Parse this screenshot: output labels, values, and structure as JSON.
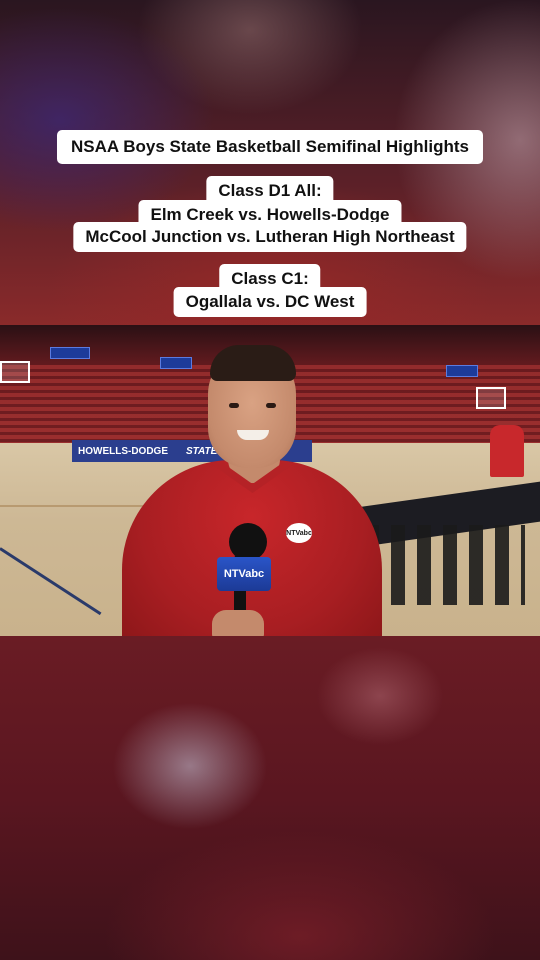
{
  "caption": {
    "title": "NSAA Boys State Basketball Semifinal Highlights",
    "d1_header": "Class D1 All:",
    "d1_game1": "Elm Creek vs. Howells-Dodge",
    "d1_game2": "McCool Junction vs. Lutheran High Northeast",
    "c1_header": "Class C1:",
    "c1_game1": "Ogallala vs. DC West"
  },
  "video": {
    "banner_left": "HOWELLS-DODGE",
    "banner_right": "STATE CHAMP",
    "mic_flag_text": "NTVabc",
    "shirt_logo_text": "NTVabc"
  },
  "colors": {
    "shirt": "#c8262a",
    "banner": "#2b3e8e",
    "caption_bg": "#ffffff"
  }
}
